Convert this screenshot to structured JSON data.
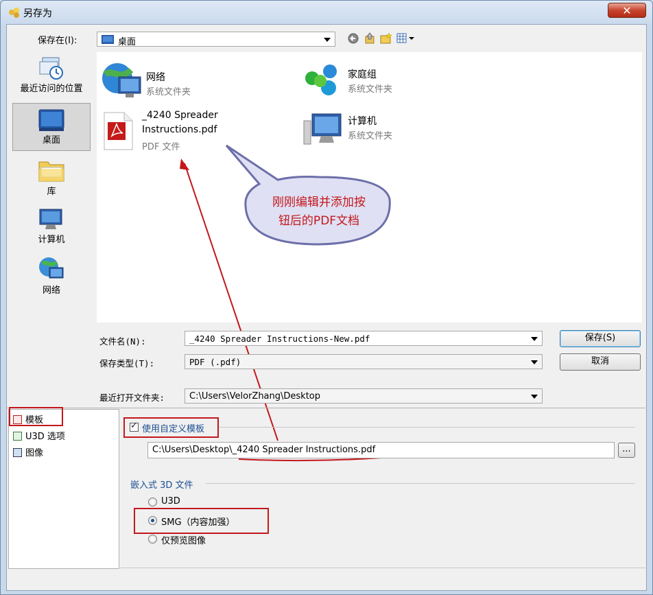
{
  "window": {
    "title": "另存为",
    "close_label": "✕"
  },
  "toolbar": {
    "save_in_label": "保存在(I):",
    "save_in_value": "桌面",
    "icons": [
      "back-icon",
      "up-folder-icon",
      "new-folder-icon",
      "view-menu-icon"
    ]
  },
  "places": [
    {
      "label": "最近访问的位置",
      "icon": "recent-places-icon",
      "selected": false
    },
    {
      "label": "桌面",
      "icon": "desktop-icon",
      "selected": true
    },
    {
      "label": "库",
      "icon": "library-icon",
      "selected": false
    },
    {
      "label": "计算机",
      "icon": "computer-icon",
      "selected": false
    },
    {
      "label": "网络",
      "icon": "network-icon",
      "selected": false
    }
  ],
  "files": [
    {
      "name": "网络",
      "type": "系统文件夹",
      "icon": "network-icon"
    },
    {
      "name": "家庭组",
      "type": "系统文件夹",
      "icon": "homegroup-icon"
    },
    {
      "name_line1": "_4240 Spreader",
      "name_line2": "Instructions.pdf",
      "type": "PDF 文件",
      "icon": "pdf-file-icon"
    },
    {
      "name": "计算机",
      "type": "系统文件夹",
      "icon": "computer-icon"
    }
  ],
  "callout": {
    "line1": "刚刚编辑并添加按",
    "line2": "钮后的PDF文档"
  },
  "form": {
    "filename_label": "文件名(N):",
    "filename_value": "_4240 Spreader Instructions-New.pdf",
    "filetype_label": "保存类型(T):",
    "filetype_value": "PDF (.pdf)",
    "save_button": "保存(S)",
    "cancel_button": "取消",
    "recent_label": "最近打开文件夹:",
    "recent_value": "C:\\Users\\VelorZhang\\Desktop"
  },
  "nav_pane": [
    {
      "label": "模板",
      "icon": "template-icon"
    },
    {
      "label": "U3D 选项",
      "icon": "u3d-icon"
    },
    {
      "label": "图像",
      "icon": "image-icon"
    }
  ],
  "options": {
    "use_custom_template_label": "使用自定义模板",
    "use_custom_template_checked": true,
    "template_path": "C:\\Users\\Desktop\\_4240 Spreader Instructions.pdf",
    "browse_button": "...",
    "embedded_3d_label": "嵌入式 3D 文件",
    "radios": [
      {
        "label": "U3D",
        "checked": false
      },
      {
        "label": "SMG（内容加强）",
        "checked": true
      },
      {
        "label": "仅预览图像",
        "checked": false
      }
    ]
  },
  "colors": {
    "annotation_red": "#c3171b",
    "callout_border": "#6c6fa8",
    "link_blue": "#1b4f93"
  }
}
